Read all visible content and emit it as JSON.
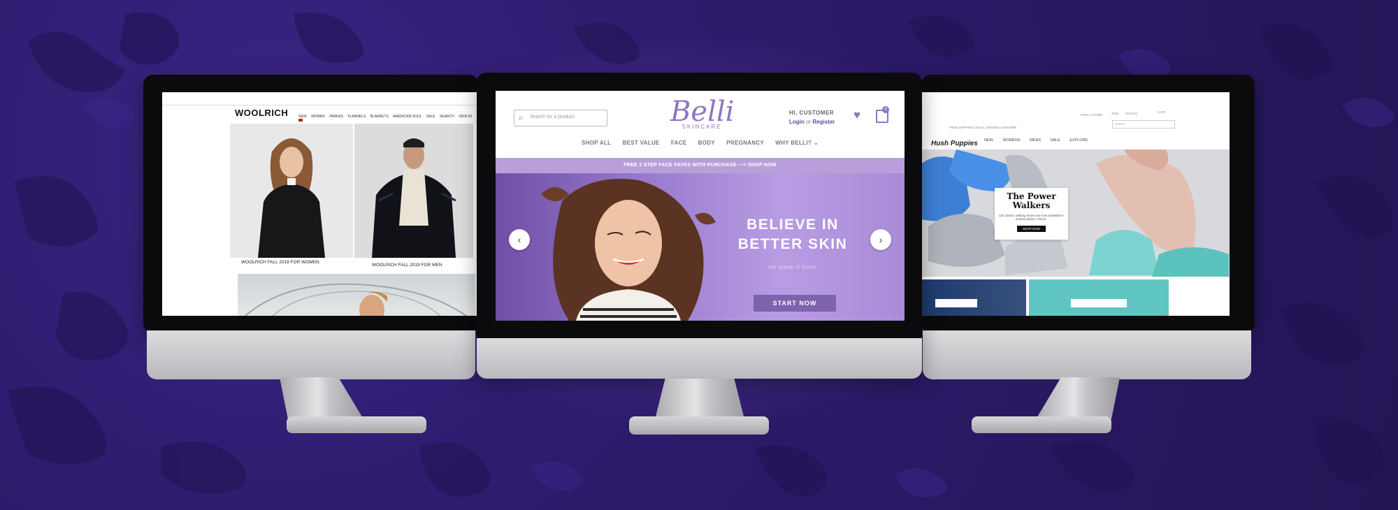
{
  "woolrich": {
    "logo": "WOOLRICH",
    "nav": [
      "NEW",
      "WOMEN",
      "PARKAS",
      "FLANNELS",
      "BLANKETS",
      "AMERICAN SOUL",
      "SALE",
      "SEARCH",
      "SIGN IN"
    ],
    "caption_women": "WOOLRICH FALL 2019 FOR WOMEN",
    "caption_men": "WOOLRICH FALL 2019 FOR MEN"
  },
  "belli": {
    "search_placeholder": "Search for a product",
    "logo": "Belli",
    "logo_sub": "SKINCARE",
    "greeting": "HI, CUSTOMER",
    "login": "Login",
    "or": "or",
    "register": "Register",
    "cart_count": "0",
    "nav": [
      "SHOP ALL",
      "BEST VALUE",
      "FACE",
      "BODY",
      "PREGNANCY",
      "WHY BELLI?"
    ],
    "promo": "FREE 3 STEP FACE FAVES WITH PURCHASE —> SHOP NOW",
    "hero_title": "BELIEVE IN BETTER SKIN",
    "hero_tagline": "WE MAKE IT EASY",
    "hero_cta": "START NOW",
    "prev_arrow": "‹",
    "next_arrow": "›"
  },
  "hush": {
    "shipping": "FREE SHIPPING ON ALL ORDERS OVER $99!",
    "top_links": [
      "FIND A STORE",
      "JOIN",
      "SIGN IN",
      "CART"
    ],
    "search_placeholder": "Search",
    "logo": "Hush Puppies",
    "nav": [
      "NEW",
      "WOMENS",
      "MENS",
      "SALE",
      "EXPLORE"
    ],
    "hero_title": "The Power Walkers",
    "hero_desc": "Our classic walking shoes are now available in limited edition colours.",
    "hero_cta": "SHOP NOW"
  },
  "colors": {
    "background": "#2c1a6a",
    "brand_purple": "#8f74c2",
    "promo_bar": "#b99fd9",
    "cta": "#7d62ad"
  }
}
